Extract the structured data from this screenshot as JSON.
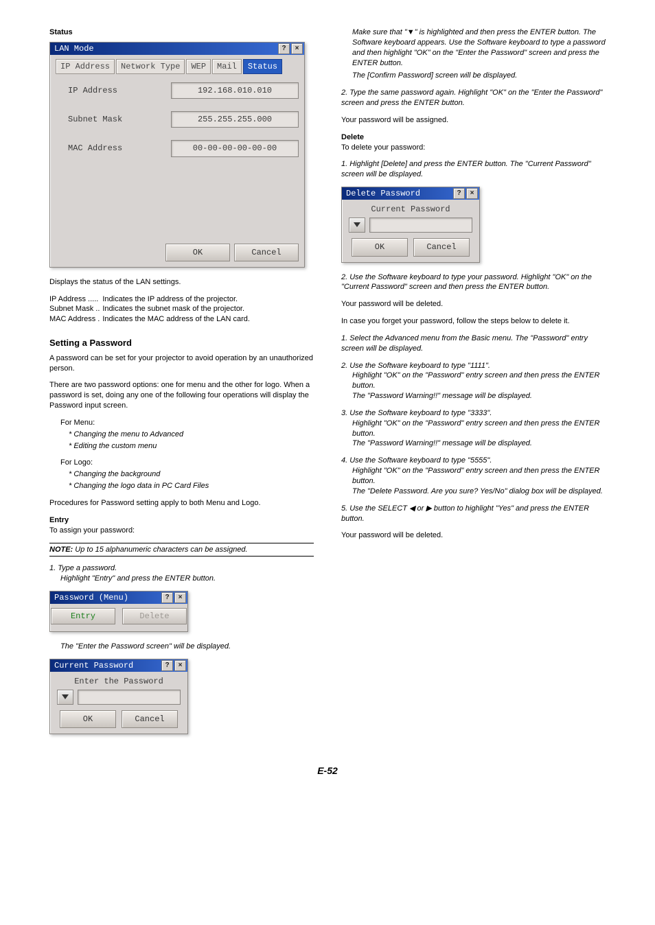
{
  "page_number": "E-52",
  "status": {
    "heading": "Status",
    "dialog": {
      "title": "LAN Mode",
      "tabs": [
        "IP Address",
        "Network Type",
        "WEP",
        "Mail",
        "Status"
      ],
      "active_tab_index": 4,
      "rows": [
        {
          "label": "IP Address",
          "value": "192.168.010.010"
        },
        {
          "label": "Subnet Mask",
          "value": "255.255.255.000"
        },
        {
          "label": "MAC Address",
          "value": "00-00-00-00-00-00"
        }
      ],
      "ok": "OK",
      "cancel": "Cancel"
    },
    "desc": "Displays the status of the LAN settings.",
    "items": [
      {
        "k": "IP Address .....",
        "v": "Indicates the IP address of the projector."
      },
      {
        "k": "Subnet Mask ..",
        "v": "Indicates the subnet mask of the projector."
      },
      {
        "k": "MAC Address .",
        "v": "Indicates the MAC address of the LAN card."
      }
    ]
  },
  "password": {
    "heading": "Setting a Password",
    "p1": "A password can be set for your projector to avoid operation by an unauthorized person.",
    "p2": "There are two password options: one for menu and the other for logo. When a password is set, doing any one of the following four operations will display the Password input screen.",
    "for_menu_label": "For Menu:",
    "menu_items": [
      "Changing the menu to Advanced",
      "Editing the custom menu"
    ],
    "for_logo_label": "For Logo:",
    "logo_items": [
      "Changing the background",
      "Changing the logo data in PC Card Files"
    ],
    "p3": "Procedures for Password setting apply to both Menu and Logo.",
    "entry_heading": "Entry",
    "entry_intro": "To assign your password:",
    "note_label": "NOTE:",
    "note_text": " Up to 15 alphanumeric characters can be assigned.",
    "step1_a": "1. Type a password.",
    "step1_b": "Highlight \"Entry\" and press the ENTER button.",
    "dlg_pwmenu": {
      "title": "Password (Menu)",
      "entry": "Entry",
      "delete": "Delete"
    },
    "after_dlg1": "The \"Enter the Password screen\" will be displayed.",
    "dlg_current": {
      "title": "Current Password",
      "label": "Enter the Password",
      "ok": "OK",
      "cancel": "Cancel"
    }
  },
  "right": {
    "p1": "Make sure that \"▼\" is highlighted and then press the ENTER button. The Software keyboard appears. Use the Software keyboard to type a password and then highlight \"OK\" on the \"Enter the Password\" screen and press the ENTER button.",
    "p1b": "The [Confirm Password] screen will be displayed.",
    "step2": "2. Type the same password again. Highlight \"OK\" on the \"Enter the Password\" screen and press the ENTER button.",
    "assigned": "Your password will be assigned.",
    "delete_heading": "Delete",
    "delete_intro": "To delete your password:",
    "del_step1": "1. Highlight [Delete] and press the ENTER button. The \"Current Password\" screen will be displayed.",
    "dlg_delete": {
      "title": "Delete Password",
      "label": "Current Password",
      "ok": "OK",
      "cancel": "Cancel"
    },
    "del_step2": "2. Use the Software keyboard to type your password. Highlight \"OK\" on the \"Current Password\" screen and then press the ENTER button.",
    "deleted": "Your password will be deleted.",
    "forgot_intro": "In case you forget your password, follow the steps below to delete it.",
    "forgot_steps": [
      [
        "1. Select the Advanced menu from the Basic menu. The \"Password\" entry screen will be displayed."
      ],
      [
        "2. Use the Software keyboard to type \"1111\".",
        "Highlight \"OK\" on the \"Password\" entry screen and then press the ENTER button.",
        "The \"Password Warning!!\" message will be displayed."
      ],
      [
        "3. Use the Software keyboard to type \"3333\".",
        "Highlight \"OK\" on the \"Password\" entry screen and then press the ENTER button.",
        "The \"Password Warning!!\" message will be displayed."
      ],
      [
        "4. Use the Software keyboard to type \"5555\".",
        "Highlight \"OK\" on the \"Password\" entry screen and then press the ENTER button.",
        "The \"Delete Password. Are you sure? Yes/No\" dialog box will be displayed."
      ],
      [
        "5. Use the SELECT ◀ or ▶ button to highlight \"Yes\" and press the ENTER button."
      ]
    ],
    "deleted2": "Your password will be deleted."
  }
}
